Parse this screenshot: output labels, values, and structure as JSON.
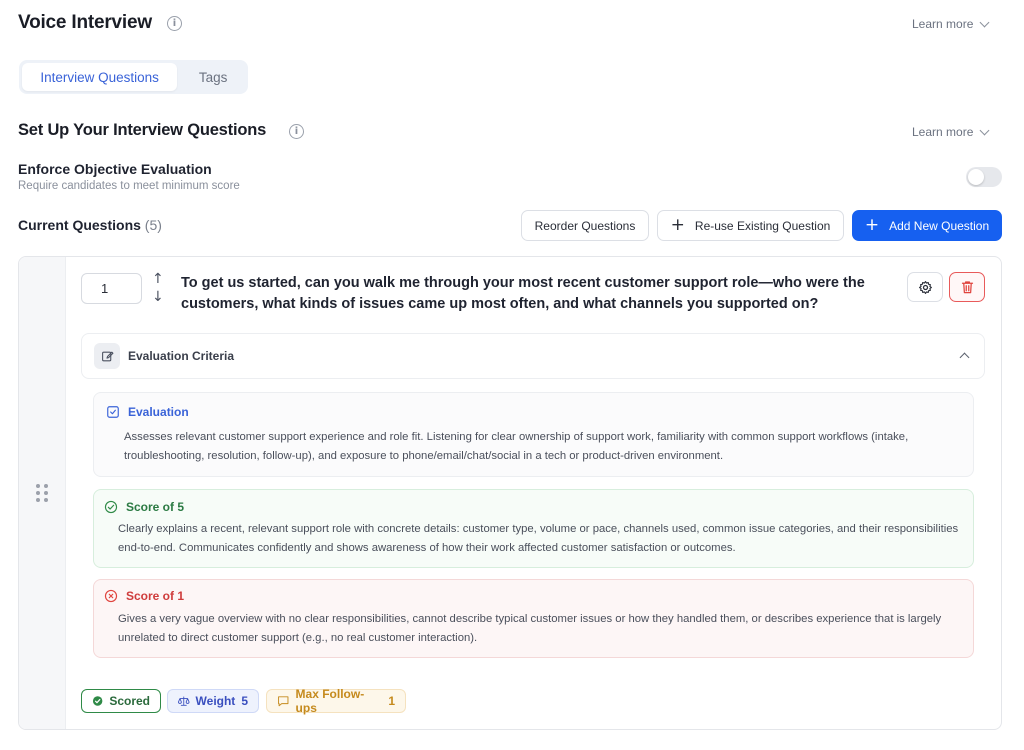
{
  "header": {
    "title": "Voice Interview",
    "learn_more": "Learn more"
  },
  "tabs": [
    {
      "label": "Interview Questions",
      "active": true
    },
    {
      "label": "Tags",
      "active": false
    }
  ],
  "setup": {
    "title": "Set Up Your Interview Questions",
    "learn_more": "Learn more"
  },
  "enforce": {
    "title": "Enforce Objective Evaluation",
    "subtitle": "Require candidates to meet minimum score",
    "enabled": false
  },
  "current": {
    "label": "Current Questions",
    "count": "(5)"
  },
  "toolbar": {
    "reorder_label": "Reorder Questions",
    "reuse_label": "Re-use Existing Question",
    "add_label": "Add New Question"
  },
  "question": {
    "number": "1",
    "text": "To get us started, can you walk me through your most recent customer support role—who were the customers, what kinds of issues came up most often, and what channels you supported on?",
    "criteria_header": "Evaluation Criteria",
    "evaluation": {
      "title": "Evaluation",
      "text": "Assesses relevant customer support experience and role fit. Listening for clear ownership of support work, familiarity with common support workflows (intake, troubleshooting, resolution, follow-up), and exposure to phone/email/chat/social in a tech or product-driven environment."
    },
    "score5": {
      "title": "Score of 5",
      "text": "Clearly explains a recent, relevant support role with concrete details: customer type, volume or pace, channels used, common issue categories, and their responsibilities end-to-end. Communicates confidently and shows awareness of how their work affected customer satisfaction or outcomes."
    },
    "score1": {
      "title": "Score of 1",
      "text": "Gives a very vague overview with no clear responsibilities, cannot describe typical customer issues or how they handled them, or describes experience that is largely unrelated to direct customer support (e.g., no real customer interaction)."
    },
    "tags": {
      "scored": "Scored",
      "weight_label": "Weight",
      "weight_value": "5",
      "followups_label": "Max Follow-ups",
      "followups_value": "1"
    }
  },
  "colors": {
    "primary": "#1660f0",
    "tab_active": "#3a63d8",
    "success": "#2f8a47",
    "danger": "#e0443e",
    "warning": "#c58a1d"
  }
}
